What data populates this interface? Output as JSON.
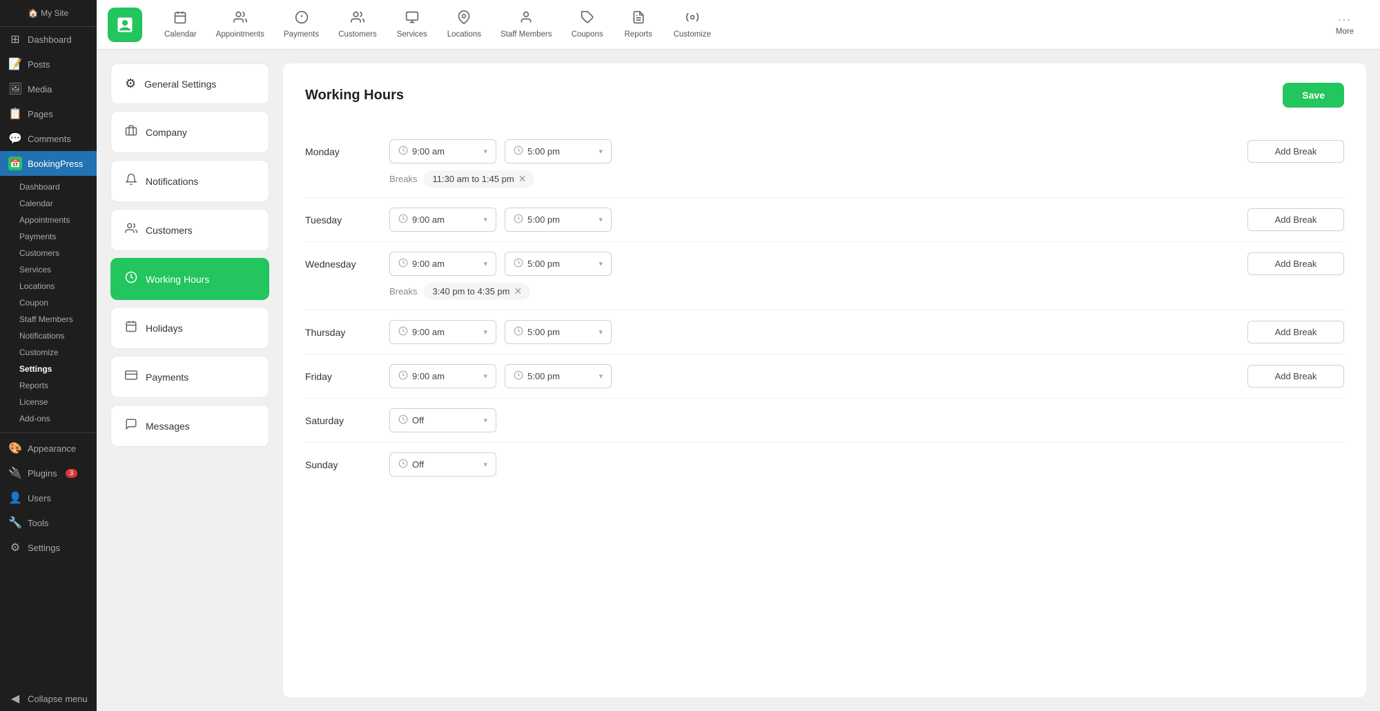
{
  "wp_sidebar": {
    "items": [
      {
        "id": "dashboard",
        "label": "Dashboard",
        "icon": "⊞"
      },
      {
        "id": "posts",
        "label": "Posts",
        "icon": "📄"
      },
      {
        "id": "media",
        "label": "Media",
        "icon": "🖼"
      },
      {
        "id": "pages",
        "label": "Pages",
        "icon": "📋"
      },
      {
        "id": "comments",
        "label": "Comments",
        "icon": "💬"
      },
      {
        "id": "bookingpress",
        "label": "BookingPress",
        "icon": "📅"
      }
    ],
    "bookingpress_submenu": [
      {
        "id": "bp-dashboard",
        "label": "Dashboard"
      },
      {
        "id": "bp-calendar",
        "label": "Calendar"
      },
      {
        "id": "bp-appointments",
        "label": "Appointments"
      },
      {
        "id": "bp-payments",
        "label": "Payments"
      },
      {
        "id": "bp-customers",
        "label": "Customers"
      },
      {
        "id": "bp-services",
        "label": "Services"
      },
      {
        "id": "bp-locations",
        "label": "Locations"
      },
      {
        "id": "bp-coupon",
        "label": "Coupon"
      },
      {
        "id": "bp-staff",
        "label": "Staff Members"
      },
      {
        "id": "bp-notifications",
        "label": "Notifications"
      },
      {
        "id": "bp-customize",
        "label": "Customize"
      },
      {
        "id": "bp-settings",
        "label": "Settings",
        "active": true
      },
      {
        "id": "bp-reports",
        "label": "Reports"
      },
      {
        "id": "bp-license",
        "label": "License"
      },
      {
        "id": "bp-addons",
        "label": "Add-ons"
      }
    ],
    "bottom_items": [
      {
        "id": "appearance",
        "label": "Appearance",
        "icon": "🎨"
      },
      {
        "id": "plugins",
        "label": "Plugins",
        "icon": "🔌",
        "badge": "3"
      },
      {
        "id": "users",
        "label": "Users",
        "icon": "👤"
      },
      {
        "id": "tools",
        "label": "Tools",
        "icon": "🔧"
      },
      {
        "id": "settings",
        "label": "Settings",
        "icon": "⚙"
      },
      {
        "id": "collapse",
        "label": "Collapse menu",
        "icon": "◀"
      }
    ]
  },
  "top_nav": {
    "items": [
      {
        "id": "calendar",
        "label": "Calendar",
        "icon": "📅"
      },
      {
        "id": "appointments",
        "label": "Appointments",
        "icon": "👤"
      },
      {
        "id": "payments",
        "label": "Payments",
        "icon": "💰"
      },
      {
        "id": "customers",
        "label": "Customers",
        "icon": "👥"
      },
      {
        "id": "services",
        "label": "Services",
        "icon": "🗂"
      },
      {
        "id": "locations",
        "label": "Locations",
        "icon": "📍"
      },
      {
        "id": "staff-members",
        "label": "Staff Members",
        "icon": "👤"
      },
      {
        "id": "coupons",
        "label": "Coupons",
        "icon": "🏷"
      },
      {
        "id": "reports",
        "label": "Reports",
        "icon": "📊"
      },
      {
        "id": "customize",
        "label": "Customize",
        "icon": "🎨"
      },
      {
        "id": "more",
        "label": "More",
        "icon": "···"
      }
    ]
  },
  "left_panel": {
    "items": [
      {
        "id": "general-settings",
        "label": "General Settings",
        "icon": "⚙"
      },
      {
        "id": "company",
        "label": "Company",
        "icon": "🏢"
      },
      {
        "id": "notifications",
        "label": "Notifications",
        "icon": "🔔"
      },
      {
        "id": "customers",
        "label": "Customers",
        "icon": "👥"
      },
      {
        "id": "working-hours",
        "label": "Working Hours",
        "icon": "🕐",
        "active": true
      },
      {
        "id": "holidays",
        "label": "Holidays",
        "icon": "📅"
      },
      {
        "id": "payments",
        "label": "Payments",
        "icon": "💳"
      },
      {
        "id": "messages",
        "label": "Messages",
        "icon": "💬"
      }
    ]
  },
  "working_hours": {
    "title": "Working Hours",
    "save_label": "Save",
    "days": [
      {
        "id": "monday",
        "label": "Monday",
        "start": "9:00 am",
        "end": "5:00 pm",
        "breaks": [
          {
            "label": "11:30 am to 1:45 pm"
          }
        ],
        "add_break_label": "Add Break",
        "off": false
      },
      {
        "id": "tuesday",
        "label": "Tuesday",
        "start": "9:00 am",
        "end": "5:00 pm",
        "breaks": [],
        "add_break_label": "Add Break",
        "off": false
      },
      {
        "id": "wednesday",
        "label": "Wednesday",
        "start": "9:00 am",
        "end": "5:00 pm",
        "breaks": [
          {
            "label": "3:40 pm to 4:35 pm"
          }
        ],
        "add_break_label": "Add Break",
        "off": false
      },
      {
        "id": "thursday",
        "label": "Thursday",
        "start": "9:00 am",
        "end": "5:00 pm",
        "breaks": [],
        "add_break_label": "Add Break",
        "off": false
      },
      {
        "id": "friday",
        "label": "Friday",
        "start": "9:00 am",
        "end": "5:00 pm",
        "breaks": [],
        "add_break_label": "Add Break",
        "off": false
      },
      {
        "id": "saturday",
        "label": "Saturday",
        "start": "Off",
        "end": null,
        "breaks": [],
        "add_break_label": null,
        "off": true
      },
      {
        "id": "sunday",
        "label": "Sunday",
        "start": "Off",
        "end": null,
        "breaks": [],
        "add_break_label": null,
        "off": true
      }
    ],
    "breaks_label": "Breaks"
  }
}
